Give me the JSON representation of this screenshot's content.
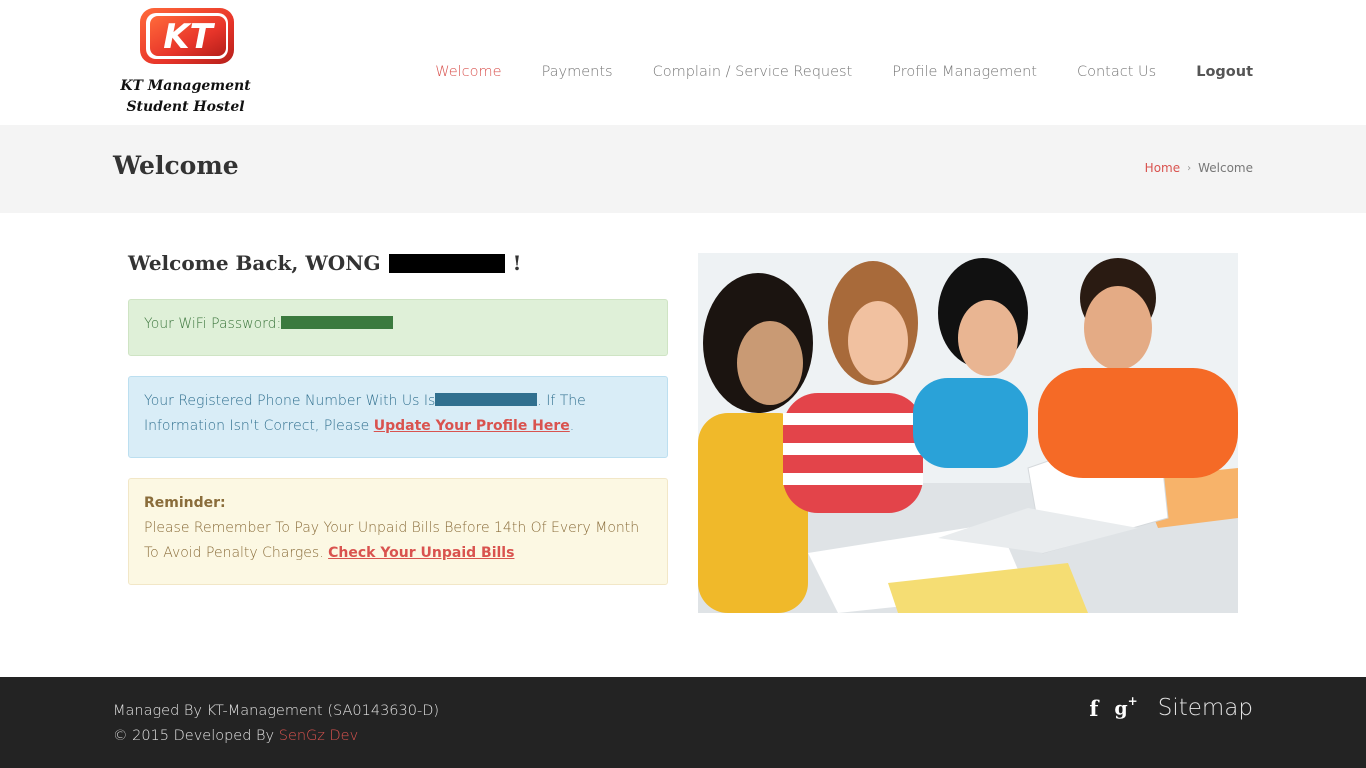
{
  "brand": {
    "logo_letters": "KT",
    "line1": "KT Management",
    "line2": "Student Hostel",
    "accent": "#e8352a"
  },
  "nav": {
    "items": [
      {
        "label": "Welcome",
        "active": true
      },
      {
        "label": "Payments"
      },
      {
        "label": "Complain / Service Request"
      },
      {
        "label": "Profile Management"
      },
      {
        "label": "Contact Us"
      },
      {
        "label": "Logout",
        "bold": true
      }
    ]
  },
  "titlebar": {
    "title": "Welcome",
    "breadcrumb": {
      "home": "Home",
      "separator": "›",
      "current": "Welcome"
    }
  },
  "main": {
    "greeting_prefix": "Welcome Back, WONG",
    "greeting_suffix": "!",
    "wifi_label": "Your WiFi Password:",
    "phone_prefix": "Your Registered Phone Number With Us Is",
    "phone_suffix": ". If The Information Isn't Correct, Please",
    "update_link": "Update Your Profile Here",
    "period": ".",
    "reminder_title": "Reminder:",
    "reminder_text": "Please Remember To Pay Your Unpaid Bills Before 14th Of Every Month To Avoid Penalty Charges.",
    "bills_link": "Check Your Unpaid Bills",
    "photo_alt": "students-with-laptop-photo"
  },
  "footer": {
    "managed": "Managed By KT-Management (SA0143630-D)",
    "developed_prefix": "© 2015 Developed By",
    "developer": "SenGz Dev",
    "facebook_glyph": "f",
    "gplus_glyph": "g",
    "gplus_sup": "+",
    "sitemap": "Sitemap"
  },
  "colors": {
    "accent_red": "#d9534f",
    "footer_bg": "#232323",
    "titlebar_bg": "#f4f4f4"
  }
}
